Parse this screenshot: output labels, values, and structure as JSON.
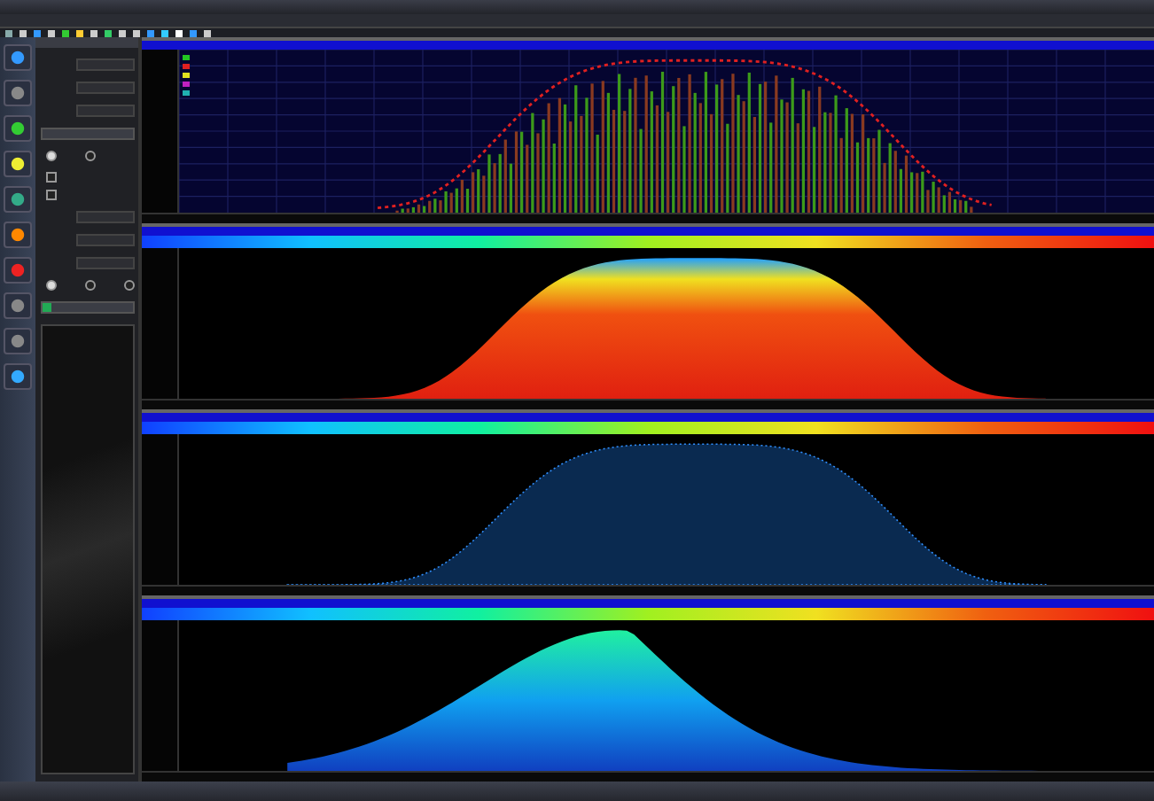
{
  "legend": [
    {
      "color": "#22c522"
    },
    {
      "color": "#e02020"
    },
    {
      "color": "#e0e020"
    },
    {
      "color": "#c020c0"
    },
    {
      "color": "#20b0b0"
    }
  ],
  "settings": {
    "radios": [
      {
        "selected": true
      },
      {
        "selected": false
      }
    ],
    "checks": [
      {
        "checked": false
      },
      {
        "checked": false
      }
    ],
    "fields": [
      {
        "kind": "field"
      },
      {
        "kind": "field"
      },
      {
        "kind": "field"
      },
      {
        "kind": "field"
      },
      {
        "kind": "field"
      },
      {
        "kind": "field"
      }
    ],
    "display": [
      {
        "selected": true
      },
      {
        "selected": false
      },
      {
        "selected": false
      }
    ]
  },
  "plots": [
    {
      "kind": "spectrum"
    },
    {
      "kind": "density"
    },
    {
      "kind": "dots"
    },
    {
      "kind": "waterfall"
    }
  ]
}
